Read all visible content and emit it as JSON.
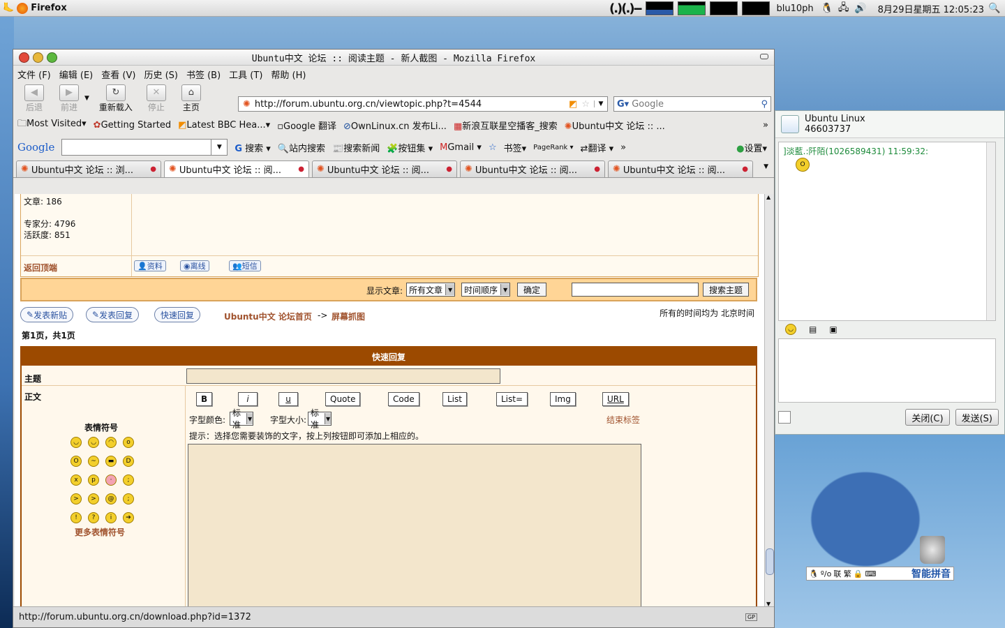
{
  "top_panel": {
    "app": "Firefox",
    "faces": "(.)(.)--",
    "user": "blu10ph",
    "clock": "8月29日星期五 12:05:23"
  },
  "window": {
    "title": "Ubuntu中文 论坛 :: 阅读主题 - 新人截图 - Mozilla Firefox"
  },
  "menu": [
    "文件 (F)",
    "编辑 (E)",
    "查看 (V)",
    "历史 (S)",
    "书签 (B)",
    "工具 (T)",
    "帮助 (H)"
  ],
  "nav": {
    "back": "后退",
    "forward": "前进",
    "reload": "重新载入",
    "stop": "停止",
    "home": "主页",
    "url": "http://forum.ubuntu.org.cn/viewtopic.php?t=4544",
    "search_placeholder": "Google"
  },
  "bookmarks": [
    "Most Visited",
    "Getting Started",
    "Latest BBC Hea...",
    "Google 翻译",
    "OwnLinux.cn 发布Li...",
    "新浪互联星空播客_搜索",
    "Ubuntu中文 论坛 :: ..."
  ],
  "google_toolbar": {
    "logo": "Google",
    "search": "搜索",
    "site_search": "站内搜索",
    "news": "搜索新闻",
    "buttons": "按钮集",
    "gmail": "Gmail",
    "bookmarks": "书签",
    "pagerank": "PageRank",
    "translate": "翻译",
    "settings": "设置"
  },
  "tabs": [
    {
      "label": "Ubuntu中文 论坛 :: 浏..."
    },
    {
      "label": "Ubuntu中文 论坛 :: 阅..."
    },
    {
      "label": "Ubuntu中文 论坛 :: 阅..."
    },
    {
      "label": "Ubuntu中文 论坛 :: 阅..."
    },
    {
      "label": "Ubuntu中文 论坛 :: 阅..."
    }
  ],
  "post": {
    "posts": "文章: 186",
    "expert": "专家分: 4796",
    "activity": "活跃度: 851",
    "back_top": "返回顶端",
    "profile": "资料",
    "offline": "离线",
    "pm": "短信"
  },
  "filter": {
    "show_label": "显示文章:",
    "all_posts": "所有文章",
    "order": "时间顺序",
    "ok": "确定",
    "search_topic": "搜索主题"
  },
  "nav_links": {
    "new_topic": "发表新贴",
    "reply": "发表回复",
    "quick_reply": "快速回复",
    "forum_home": "Ubuntu中文 论坛首页",
    "arrow": "->",
    "section": "屏幕抓图",
    "timezone": "所有的时间均为 北京时间",
    "page": "第1页，共1页"
  },
  "quick_reply": {
    "header": "快速回复",
    "subject": "主题",
    "body": "正文",
    "emoticons": "表情符号",
    "more_emoticons": "更多表情符号",
    "fmt": [
      "B",
      "i",
      "u",
      "Quote",
      "Code",
      "List",
      "List=",
      "Img",
      "URL"
    ],
    "font_color_label": "字型颜色:",
    "font_color": "标准",
    "font_size_label": "字型大小:",
    "font_size": "标准",
    "close_tags": "结束标签",
    "hint": "提示：选择您需要装饰的文字，按上列按钮即可添加上相应的。"
  },
  "status_url": "http://forum.ubuntu.org.cn/download.php?id=1372",
  "qq": {
    "name": "Ubuntu Linux",
    "number": "46603737",
    "message": "]淡藍.:阡陌(1026589431) 11:59:32:",
    "close": "关闭(C)",
    "send": "发送(S)"
  },
  "ime": {
    "label": "智能拼音",
    "chars": "联 繁"
  }
}
